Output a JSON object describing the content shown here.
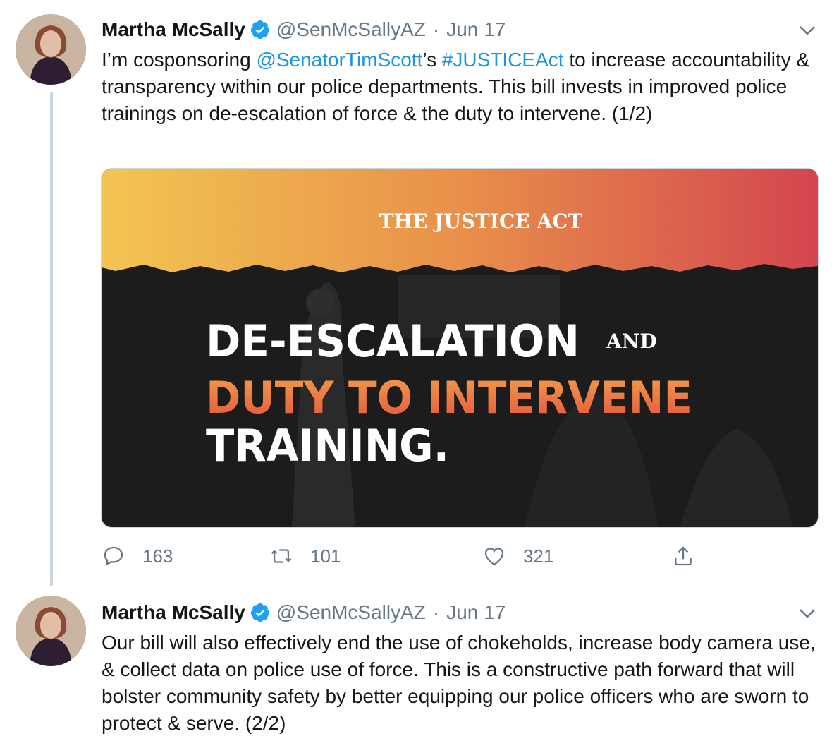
{
  "tweets": [
    {
      "name": "Martha McSally",
      "handle": "@SenMcSallyAZ",
      "separator": "·",
      "date": "Jun 17",
      "text_parts": {
        "t1": "I’m cosponsoring ",
        "mention": "@SenatorTimScott",
        "t2": "’s ",
        "hashtag": "#JUSTICEAct",
        "t3": " to increase accountability & transparency within our police departments. This bill invests in improved police trainings on de-escalation of force & the duty to intervene. (1/2)"
      },
      "media": {
        "banner": "THE JUSTICE ACT",
        "line1": "DE-ESCALATION",
        "and": "AND",
        "line2": "DUTY TO INTERVENE",
        "line3": "TRAINING."
      },
      "actions": {
        "reply_count": "163",
        "retweet_count": "101",
        "like_count": "321"
      }
    },
    {
      "name": "Martha McSally",
      "handle": "@SenMcSallyAZ",
      "separator": "·",
      "date": "Jun 17",
      "text": "Our bill will also effectively end the use of chokeholds, increase body camera use, & collect data on police use of force. This is a constructive path forward that will bolster community safety by better equipping our police officers who are sworn to protect & serve. (2/2)"
    }
  ],
  "colors": {
    "link": "#1b95e0",
    "verified": "#1da1f2",
    "muted": "#657786",
    "banner_gradient": [
      "#f3c552",
      "#e8904a",
      "#d4454f"
    ],
    "highlight_text": "#ee7d3f"
  },
  "icons": [
    "verified-badge-icon",
    "chevron-down-icon",
    "reply-icon",
    "retweet-icon",
    "like-icon",
    "share-icon"
  ]
}
